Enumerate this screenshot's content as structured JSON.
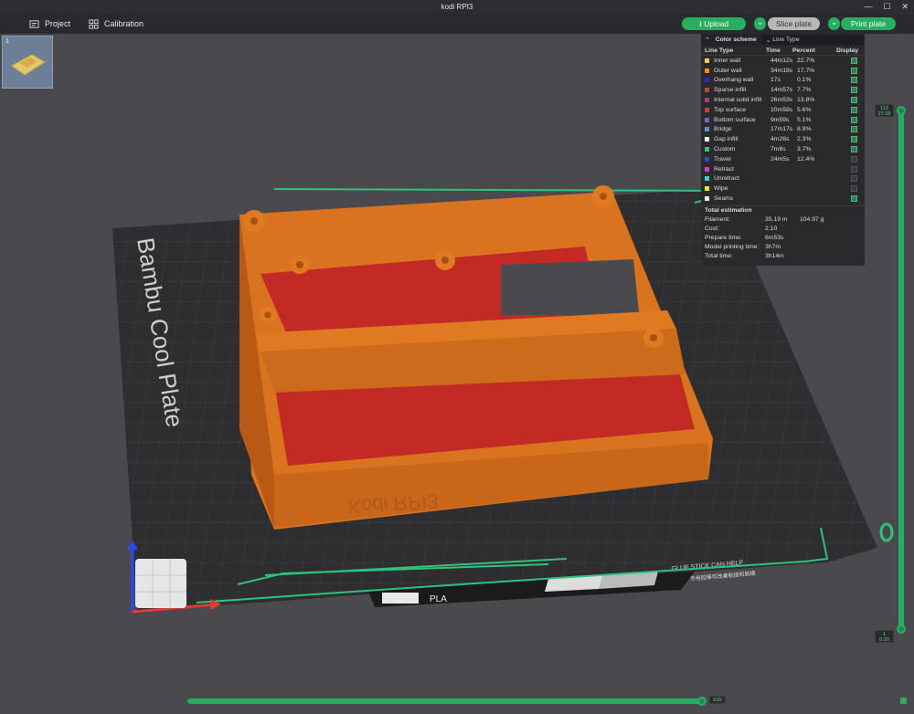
{
  "window": {
    "title": "kodi RPI3",
    "controls": [
      "—",
      "☐",
      "✕"
    ]
  },
  "menubar": {
    "project_label": "Project",
    "calibration_label": "Calibration"
  },
  "actions": {
    "upload_label": "Upload",
    "slice_label": "Slice plate",
    "print_label": "Print plate",
    "dropdown_glyph": "⌄"
  },
  "plate": {
    "thumb_number": "1",
    "bed_label": "Bambu Cool Plate",
    "bed_notice": "GLUE STICK CAN HELP",
    "bed_notice_cn": "专用胶棒可改善粘接和脱模",
    "filament_label": "PLA",
    "model_text": "Kodi RPI3"
  },
  "legend": {
    "scheme_label": "Color scheme",
    "scheme_value": "Line Type",
    "headers": {
      "type": "Line Type",
      "time": "Time",
      "percent": "Percent",
      "display": "Display"
    },
    "rows": [
      {
        "name": "Inner wall",
        "time": "44m12s",
        "pct": "22.7%",
        "color": "#e6d44a",
        "on": true
      },
      {
        "name": "Outer wall",
        "time": "34m18s",
        "pct": "17.7%",
        "color": "#f08c2a",
        "on": true
      },
      {
        "name": "Overhang wall",
        "time": "17s",
        "pct": "0.1%",
        "color": "#2a2ad8",
        "on": true
      },
      {
        "name": "Sparse infill",
        "time": "14m57s",
        "pct": "7.7%",
        "color": "#b44d32",
        "on": true
      },
      {
        "name": "Internal solid infill",
        "time": "26m53s",
        "pct": "13.8%",
        "color": "#a83a8c",
        "on": true
      },
      {
        "name": "Top surface",
        "time": "10m58s",
        "pct": "5.6%",
        "color": "#d63a3a",
        "on": true
      },
      {
        "name": "Bottom surface",
        "time": "9m59s",
        "pct": "5.1%",
        "color": "#6a6ad8",
        "on": true
      },
      {
        "name": "Bridge",
        "time": "17m17s",
        "pct": "8.9%",
        "color": "#5c8fc4",
        "on": true
      },
      {
        "name": "Gap infill",
        "time": "4m26s",
        "pct": "2.3%",
        "color": "#ffffff",
        "on": true
      },
      {
        "name": "Custom",
        "time": "7m8s",
        "pct": "3.7%",
        "color": "#3fbf76",
        "on": true
      },
      {
        "name": "Travel",
        "time": "24m5s",
        "pct": "12.4%",
        "color": "#2f4fb8",
        "on": false
      },
      {
        "name": "Retract",
        "time": "",
        "pct": "",
        "color": "#d43ad4",
        "on": false
      },
      {
        "name": "Unretract",
        "time": "",
        "pct": "",
        "color": "#3ad4d4",
        "on": false
      },
      {
        "name": "Wipe",
        "time": "",
        "pct": "",
        "color": "#e8e83a",
        "on": false
      },
      {
        "name": "Seams",
        "time": "",
        "pct": "",
        "color": "#e8e8e8",
        "on": true
      }
    ],
    "estimation_title": "Total estimation",
    "filament_k": "Filament:",
    "filament_v1": "35.19 m",
    "filament_v2": "104.97 g",
    "cost_k": "Cost:",
    "cost_v": "2.10",
    "prepare_k": "Prepare time:",
    "prepare_v": "6m53s",
    "model_time_k": "Model printing time:",
    "model_time_v": "3h7m",
    "total_k": "Total time:",
    "total_v": "3h14m"
  },
  "sliders": {
    "layer_top": "113",
    "height_top": "27.08",
    "layer_bottom": "1",
    "height_bottom": "0.20",
    "move_value": "635"
  },
  "colors": {
    "accent": "#27ae60",
    "model": "#d9731f",
    "top_surface": "#c42a25",
    "bed": "#2f2f31"
  }
}
